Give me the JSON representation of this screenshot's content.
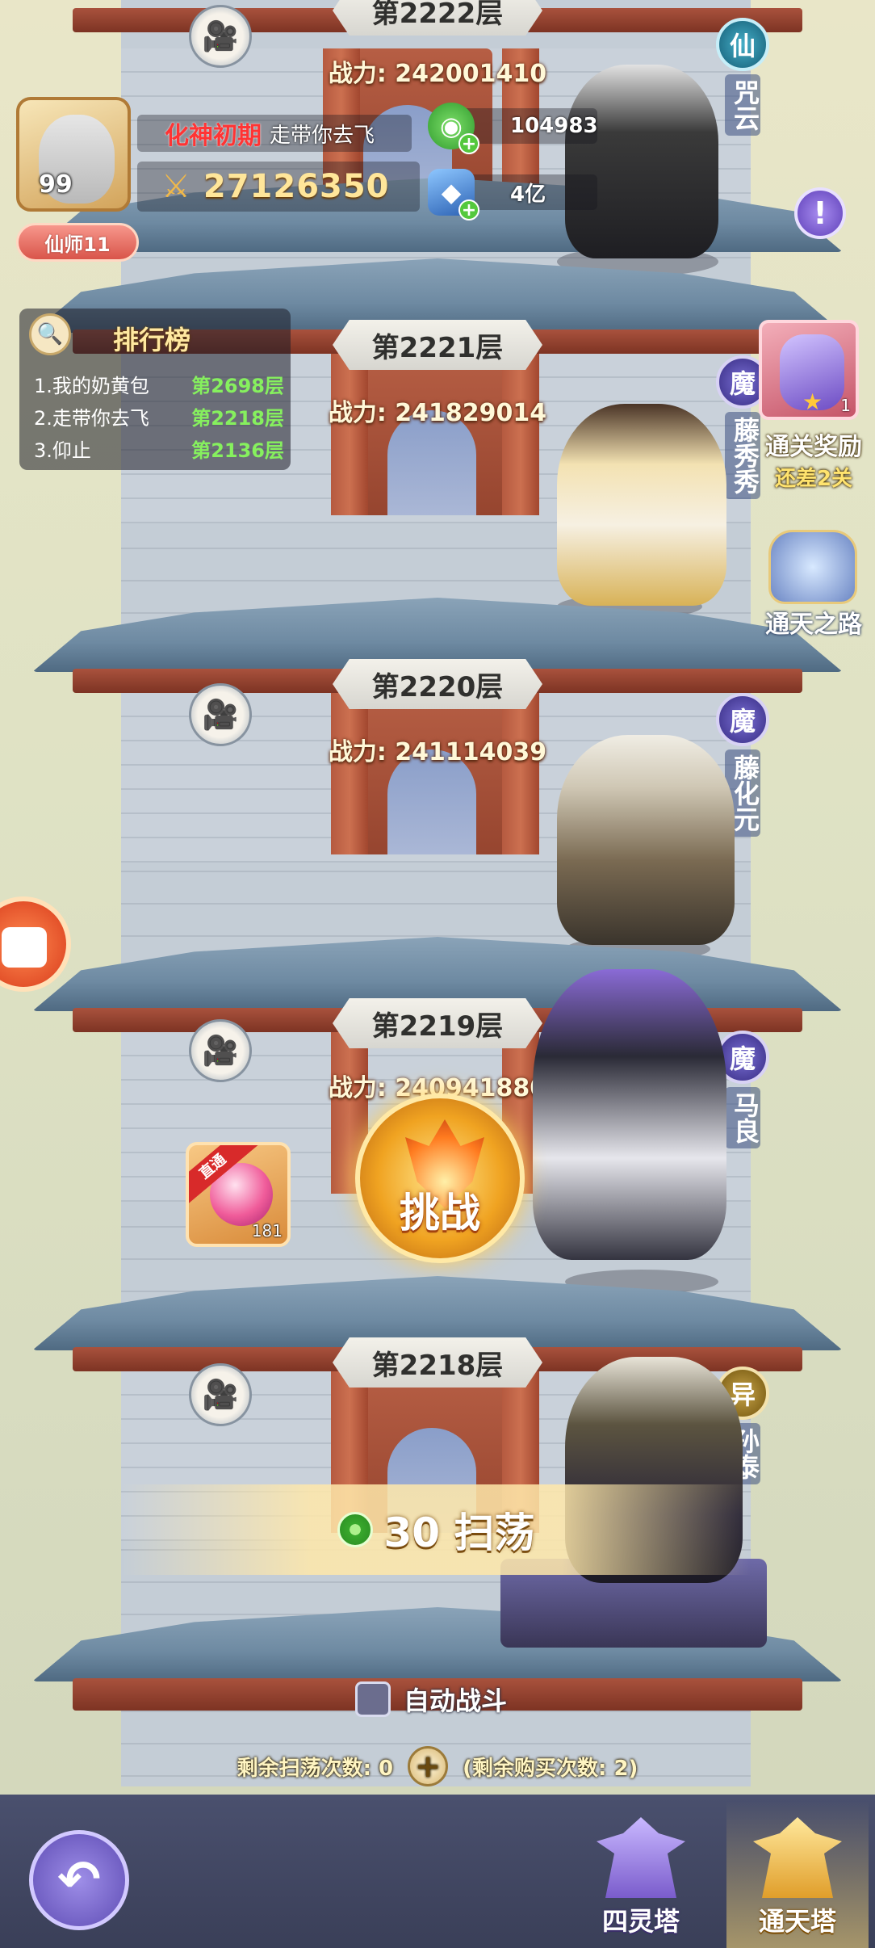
{
  "player": {
    "level": "99",
    "realm": "化神初期",
    "name": "走带你去飞",
    "power": "27126350",
    "title": "仙师11"
  },
  "resources": {
    "jade": "104983",
    "gem": "4亿"
  },
  "ranking": {
    "title": "排行榜",
    "entries": [
      {
        "name": "1.我的奶黄包",
        "floor": "第2698层"
      },
      {
        "name": "2.走带你去飞",
        "floor": "第2218层"
      },
      {
        "name": "3.仰止",
        "floor": "第2136层"
      }
    ]
  },
  "floors": [
    {
      "label": "第2222层",
      "power": "战力: 242001410",
      "faction": "仙",
      "enemy": "咒云"
    },
    {
      "label": "第2221层",
      "power": "战力: 241829014",
      "faction": "魔",
      "enemy": "藤秀秀"
    },
    {
      "label": "第2220层",
      "power": "战力: 241114039",
      "faction": "魔",
      "enemy": "藤化元"
    },
    {
      "label": "第2219层",
      "power": "战力: 240941880",
      "faction": "魔",
      "enemy": "马良"
    },
    {
      "label": "第2218层",
      "power": "",
      "faction": "异",
      "enemy": "孙泰"
    }
  ],
  "reward": {
    "count": "1",
    "label": "通关奖励",
    "sub": "还差2关"
  },
  "tianlu": {
    "label": "通天之路"
  },
  "item": {
    "ribbon": "直通",
    "count": "181"
  },
  "challenge": {
    "label": "挑战"
  },
  "sweep": {
    "label": "30 扫荡"
  },
  "auto_fight": {
    "label": "自动战斗"
  },
  "sweep_info": {
    "remaining": "剩余扫荡次数: 0",
    "buy": "(剩余购买次数: 2)"
  },
  "tabs": [
    {
      "label": "四灵塔"
    },
    {
      "label": "通天塔"
    }
  ],
  "colors": {
    "realm": "#ff3434",
    "floor_rank": "#86f05e",
    "power_text": "#fff8d8",
    "gold": "#ffe69a"
  }
}
